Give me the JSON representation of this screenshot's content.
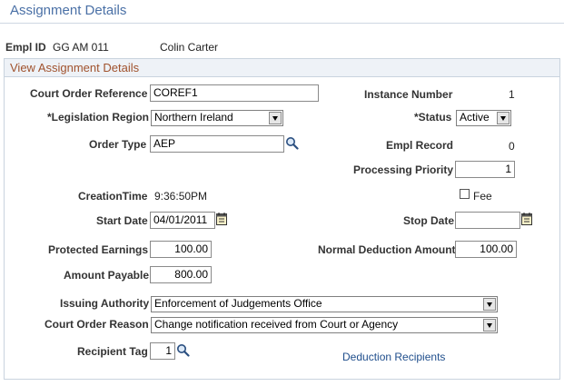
{
  "page": {
    "title": "Assignment Details"
  },
  "header": {
    "empl_id_label": "Empl ID",
    "empl_id": "GG AM 011",
    "name": "Colin Carter"
  },
  "section": {
    "title": "View Assignment Details"
  },
  "fields": {
    "court_order_reference": {
      "label": "Court Order Reference",
      "value": "COREF1"
    },
    "instance_number": {
      "label": "Instance Number",
      "value": "1"
    },
    "legislation_region": {
      "label": "*Legislation Region",
      "value": "Northern Ireland"
    },
    "status": {
      "label": "*Status",
      "value": "Active"
    },
    "order_type": {
      "label": "Order Type",
      "value": "AEP"
    },
    "empl_record": {
      "label": "Empl Record",
      "value": "0"
    },
    "processing_priority": {
      "label": "Processing Priority",
      "value": "1"
    },
    "creation_time": {
      "label": "CreationTime",
      "value": "9:36:50PM"
    },
    "fee": {
      "label": "Fee",
      "checked": false
    },
    "start_date": {
      "label": "Start Date",
      "value": "04/01/2011"
    },
    "stop_date": {
      "label": "Stop Date",
      "value": ""
    },
    "protected_earnings": {
      "label": "Protected Earnings",
      "value": "100.00"
    },
    "normal_deduction_amount": {
      "label": "Normal Deduction Amount",
      "value": "100.00"
    },
    "amount_payable": {
      "label": "Amount Payable",
      "value": "800.00"
    },
    "issuing_authority": {
      "label": "Issuing Authority",
      "value": "Enforcement of Judgements Office"
    },
    "court_order_reason": {
      "label": "Court Order Reason",
      "value": "Change notification received from Court or Agency"
    },
    "recipient_tag": {
      "label": "Recipient Tag",
      "value": "1"
    }
  },
  "links": {
    "deduction_recipients": "Deduction Recipients"
  },
  "icons": {
    "lookup": "magnifier-icon",
    "calendar": "calendar-icon",
    "dropdown": "chevron-down-icon"
  }
}
